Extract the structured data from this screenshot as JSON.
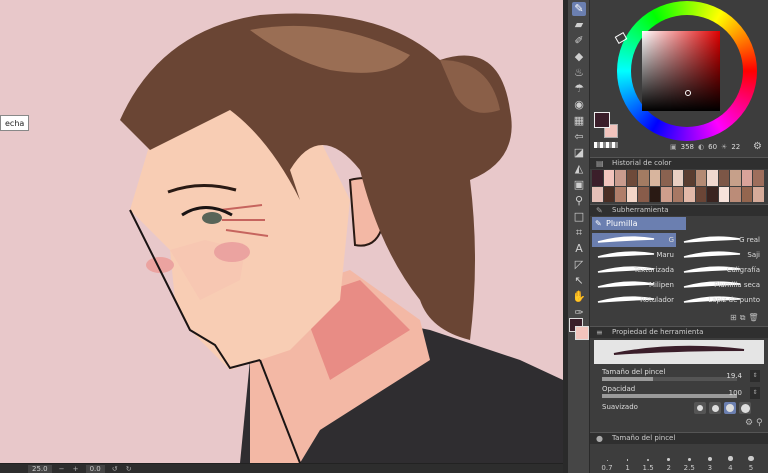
{
  "canvas": {
    "tooltip": "echa",
    "background": "#e8c8ca"
  },
  "statusbar": {
    "zoom": "25.0",
    "angle": "0.0"
  },
  "colors": {
    "main": "#3b1e2a",
    "sub": "#f2c4bd",
    "accent": "#6b7fb0"
  },
  "color_wheel": {
    "h": "358",
    "s": "60",
    "v": "22"
  },
  "history": {
    "title": "Historial de color",
    "cells": [
      "#3b1e2a",
      "#f2c4bd",
      "#c99b8e",
      "#6e4a3a",
      "#a37b62",
      "#d8b59e",
      "#8a6250",
      "#e9cfc2",
      "#5a3d30",
      "#b48a74",
      "#f0d8cf",
      "#7c5646",
      "#c6a08a",
      "#d9a39a",
      "#9e6e5c",
      "#e6c0b8",
      "#4a2e24",
      "#b07e6a",
      "#f4d6c8",
      "#885c4a",
      "#2a1a14",
      "#cf9e8c",
      "#a77864",
      "#e2b8a8",
      "#6a4536",
      "#3a2420",
      "#f7e2da",
      "#bb8c78",
      "#94664f",
      "#d6ab9a"
    ]
  },
  "subtool": {
    "panel_title": "Subherramienta",
    "group": "Plumilla",
    "brushes": [
      {
        "label": "G",
        "selected": true
      },
      {
        "label": "G real",
        "selected": false
      },
      {
        "label": "Maru",
        "selected": false
      },
      {
        "label": "Saji",
        "selected": false
      },
      {
        "label": "Texturizada",
        "selected": false
      },
      {
        "label": "Caligrafía",
        "selected": false
      },
      {
        "label": "Milipen",
        "selected": false
      },
      {
        "label": "Plumilla seca",
        "selected": false
      },
      {
        "label": "Rotulador",
        "selected": false
      },
      {
        "label": "Lápiz de punto",
        "selected": false
      }
    ]
  },
  "tool_property": {
    "title": "Propiedad de herramienta",
    "brush_size_label": "Tamaño del pincel",
    "brush_size_value": "19.4",
    "brush_size_fraction": 0.38,
    "opacity_label": "Opacidad",
    "opacity_value": "100",
    "opacity_fraction": 1.0,
    "smoothing_label": "Suavizado"
  },
  "brush_size_panel": {
    "title": "Tamaño del pincel",
    "sizes": [
      "0.7",
      "1",
      "1.5",
      "2",
      "2.5",
      "3",
      "4",
      "5"
    ]
  }
}
